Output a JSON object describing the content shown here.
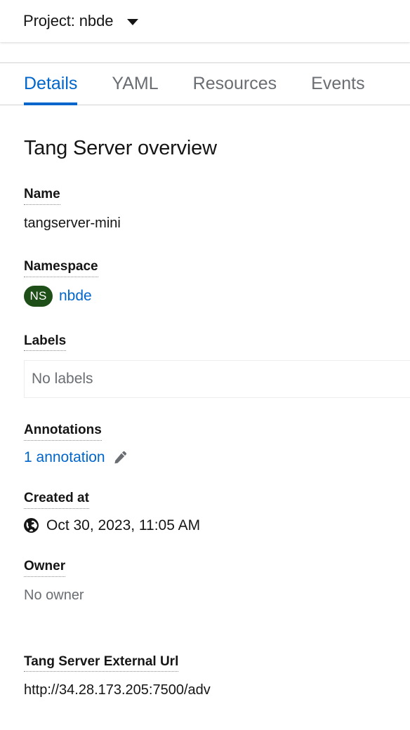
{
  "project_bar": {
    "label": "Project: nbde",
    "caret_icon": "chevron-down-icon"
  },
  "tabs": [
    {
      "label": "Details",
      "active": true
    },
    {
      "label": "YAML",
      "active": false
    },
    {
      "label": "Resources",
      "active": false
    },
    {
      "label": "Events",
      "active": false
    }
  ],
  "overview": {
    "title": "Tang Server overview"
  },
  "fields": {
    "name": {
      "label": "Name",
      "value": "tangserver-mini"
    },
    "namespace": {
      "label": "Namespace",
      "badge": "NS",
      "badge_color": "#1e4f18",
      "link": "nbde",
      "link_color": "#0066cc"
    },
    "labels": {
      "label": "Labels",
      "empty_text": "No labels"
    },
    "annotations": {
      "label": "Annotations",
      "link": "1 annotation",
      "edit_icon": "pencil-icon"
    },
    "created_at": {
      "label": "Created at",
      "icon": "globe-icon",
      "value": "Oct 30, 2023, 11:05 AM"
    },
    "owner": {
      "label": "Owner",
      "value": "No owner"
    },
    "external_url": {
      "label": "Tang Server External Url",
      "value": "http://34.28.173.205:7500/adv"
    }
  },
  "theme": {
    "accent": "#0066cc",
    "text": "#151515",
    "muted": "#6a6e73",
    "border": "#d2d2d2"
  }
}
